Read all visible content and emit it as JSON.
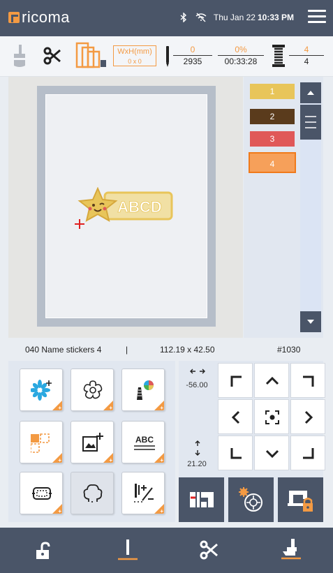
{
  "app": {
    "brand": "ricoma"
  },
  "status_bar": {
    "date": "Thu Jan 22",
    "time": "10:33 PM",
    "bluetooth_icon": "bluetooth-icon",
    "wifi_icon": "wifi-off-icon"
  },
  "toolbar": {
    "size_label": "WxH(mm)",
    "size_value": "0 x 0",
    "stitch_current": "0",
    "stitch_total": "2935",
    "progress_percent": "0%",
    "time_remaining": "00:33:28",
    "color_current": "4",
    "color_total": "4"
  },
  "colors": [
    {
      "label": "1",
      "color": "#e8c55a"
    },
    {
      "label": "2",
      "color": "#5a3b1c"
    },
    {
      "label": "3",
      "color": "#e05858"
    },
    {
      "label": "4",
      "color": "#f6a05a",
      "selected": true
    }
  ],
  "design": {
    "text": "ABCD",
    "name": "040 Name stickers 4",
    "separator": "|",
    "size": "112.19 x 42.50",
    "id": "#1030"
  },
  "position": {
    "x": "-56.00",
    "y": "21.20"
  },
  "accent_color": "#f39a43",
  "dark_color": "#4a5568"
}
